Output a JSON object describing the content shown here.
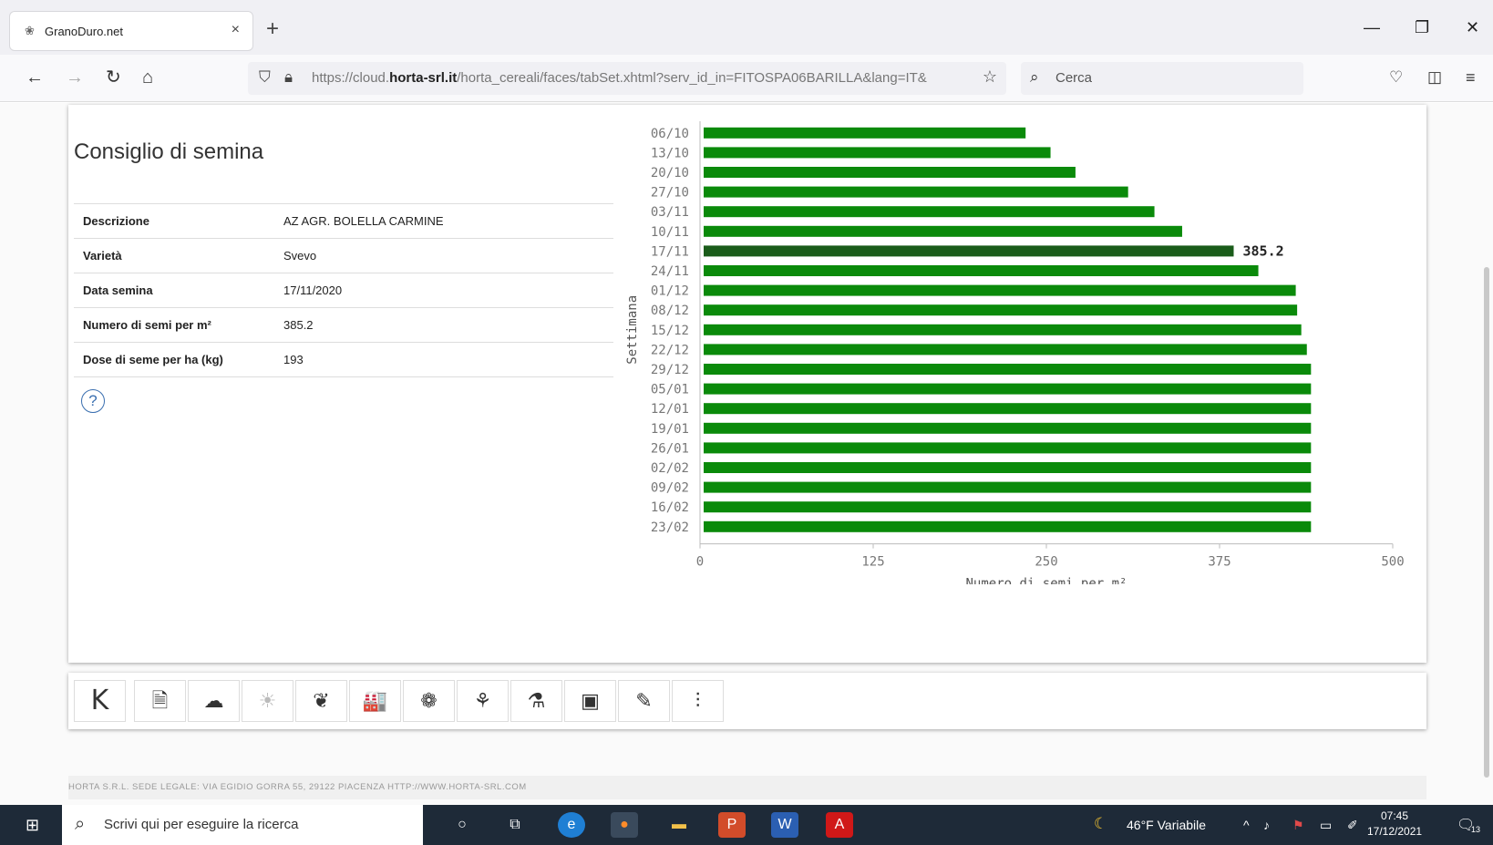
{
  "browser": {
    "tab_title": "GranoDuro.net",
    "tab_close": "×",
    "new_tab": "+",
    "url_prefix": "https://cloud.",
    "url_host": "horta-srl.it",
    "url_rest": "/horta_cereali/faces/tabSet.xhtml?serv_id_in=FITOSPA06BARILLA&lang=IT&",
    "search_placeholder": "Cerca"
  },
  "card": {
    "title": "Consiglio di semina",
    "rows": [
      {
        "label": "Descrizione",
        "value": "AZ AGR. BOLELLA CARMINE"
      },
      {
        "label": "Varietà",
        "value": "Svevo"
      },
      {
        "label": "Data semina",
        "value": "17/11/2020"
      },
      {
        "label": "Numero di semi per m²",
        "value": "385.2"
      },
      {
        "label": "Dose di seme per ha (kg)",
        "value": "193"
      }
    ],
    "help": "?"
  },
  "chart_data": {
    "type": "bar",
    "orientation": "horizontal",
    "categories": [
      "06/10",
      "13/10",
      "20/10",
      "27/10",
      "03/11",
      "10/11",
      "17/11",
      "24/11",
      "01/12",
      "08/12",
      "15/12",
      "22/12",
      "29/12",
      "05/01",
      "12/01",
      "19/01",
      "26/01",
      "02/02",
      "09/02",
      "16/02",
      "23/02"
    ],
    "values": [
      235,
      253,
      271,
      309,
      328,
      348,
      385.2,
      403,
      430,
      431,
      434,
      438,
      441,
      441,
      441,
      441,
      441,
      441,
      441,
      441,
      441
    ],
    "highlight_index": 6,
    "highlight_label": "385.2",
    "xlabel": "Numero di semi per m²",
    "ylabel": "Settimana",
    "xlim": [
      0,
      500
    ],
    "xticks": [
      "0",
      "125",
      "250",
      "375",
      "500"
    ],
    "colors": {
      "bar": "#0a8a0a",
      "highlight": "#1a5c1a"
    },
    "grid": false
  },
  "toolbar": {
    "items": [
      {
        "name": "back-k-icon",
        "glyph": "K"
      },
      {
        "name": "document-icon",
        "glyph": "🗎"
      },
      {
        "name": "cloud-icon",
        "glyph": "☁"
      },
      {
        "name": "sun-icon",
        "glyph": "☀"
      },
      {
        "name": "leaf-icon",
        "glyph": "❦"
      },
      {
        "name": "factory-icon",
        "glyph": "🏭"
      },
      {
        "name": "fan-icon",
        "glyph": "❁"
      },
      {
        "name": "plant-icon",
        "glyph": "⚘"
      },
      {
        "name": "flask-icon",
        "glyph": "⚗"
      },
      {
        "name": "box-icon",
        "glyph": "▣"
      },
      {
        "name": "edit-icon",
        "glyph": "✎"
      },
      {
        "name": "sliders-icon",
        "glyph": "⫶"
      }
    ]
  },
  "footer": {
    "text": "HORTA S.R.L. SEDE LEGALE: VIA EGIDIO GORRA 55, 29122 PIACENZA HTTP://WWW.HORTA-SRL.COM"
  },
  "taskbar": {
    "search_text": "Scrivi qui per eseguire la ricerca",
    "weather": "46°F  Variabile",
    "time": "07:45",
    "date": "17/12/2021",
    "notifications": "13"
  }
}
